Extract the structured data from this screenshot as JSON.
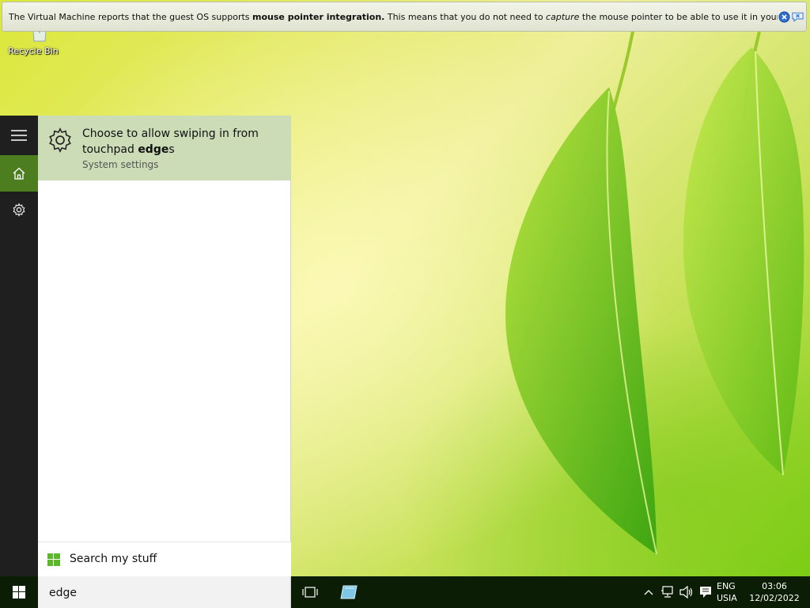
{
  "vm_notice": {
    "text_1": "The Virtual Machine reports that the guest OS supports ",
    "bold": "mouse pointer integration.",
    "text_2": " This means that you do not need to ",
    "italic": "capture",
    "text_3": " the mouse pointer to be able to use it in your guest OS -- all mouse",
    "close_icon": "close-circle-icon",
    "do_not_show_icon": "speech-bubble-cross-icon"
  },
  "desktop": {
    "recycle_bin_label": "Recycle Bin"
  },
  "start_rail": {
    "items": [
      {
        "icon": "hamburger-icon",
        "active": false
      },
      {
        "icon": "home-icon",
        "active": true
      },
      {
        "icon": "gear-icon",
        "active": false
      }
    ]
  },
  "search_results": {
    "top_result": {
      "title_prefix": "Choose to allow swiping in from touchpad ",
      "title_bold": "edge",
      "title_suffix": "s",
      "subtitle": "System settings",
      "icon": "gear-icon"
    },
    "search_my_stuff_label": "Search my stuff"
  },
  "taskbar": {
    "search_value": "edge",
    "tray": {
      "lang_line1": "ENG",
      "lang_line2": "USIA",
      "time": "03:06",
      "date": "12/02/2022"
    }
  },
  "colors": {
    "accent": "#4c7e1f",
    "result_highlight": "#cbdcb7",
    "taskbar": "#0c1d06",
    "rail": "#1f1f1f"
  }
}
